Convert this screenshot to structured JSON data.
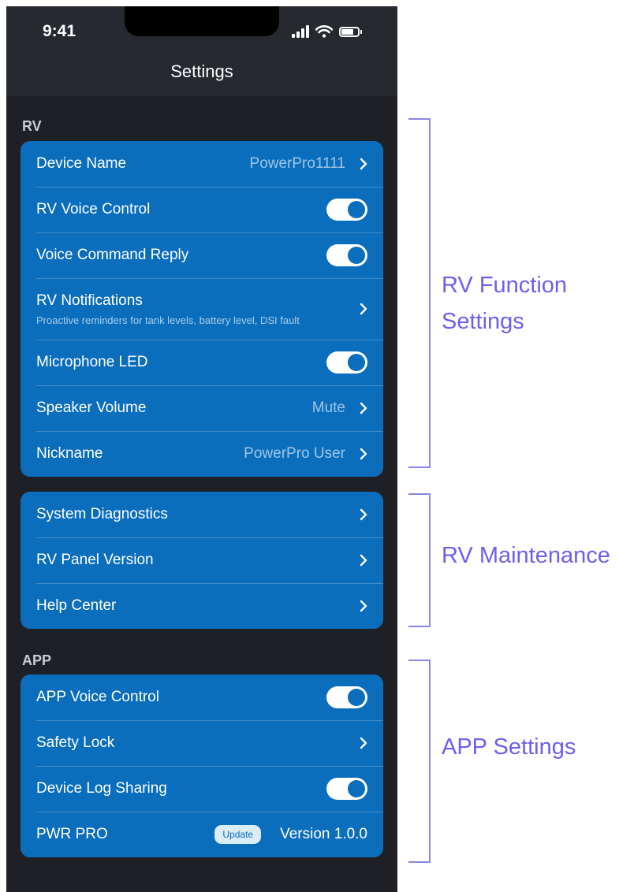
{
  "status_bar": {
    "time": "9:41"
  },
  "nav": {
    "title": "Settings"
  },
  "rv_section": {
    "label": "RV",
    "rows": [
      {
        "label": "Device Name",
        "value": "PowerPro1111"
      },
      {
        "label": "RV Voice Control",
        "toggle": true
      },
      {
        "label": "Voice Command Reply",
        "toggle": true
      },
      {
        "label": "RV Notifications",
        "subtitle": "Proactive reminders for tank levels, battery level, DSI fault"
      },
      {
        "label": "Microphone LED",
        "toggle": true
      },
      {
        "label": "Speaker Volume",
        "value": "Mute"
      },
      {
        "label": "Nickname",
        "value": "PowerPro User"
      }
    ]
  },
  "maintenance_section": {
    "rows": [
      {
        "label": "System Diagnostics"
      },
      {
        "label": "RV Panel Version"
      },
      {
        "label": "Help Center"
      }
    ]
  },
  "app_section": {
    "label": "APP",
    "rows": [
      {
        "label": "APP Voice Control",
        "toggle": true
      },
      {
        "label": "Safety Lock"
      },
      {
        "label": "Device Log Sharing",
        "toggle": true
      },
      {
        "label": "PWR PRO",
        "badge": "Update",
        "value": "Version 1.0.0"
      }
    ]
  },
  "annotations": {
    "rv_function_line1": "RV Function",
    "rv_function_line2": "Settings",
    "rv_maintenance": "RV Maintenance",
    "app_settings": "APP Settings"
  },
  "colors": {
    "card": "#0a6ebd",
    "background": "#1e2025",
    "annotation": "#6d5ff0"
  }
}
